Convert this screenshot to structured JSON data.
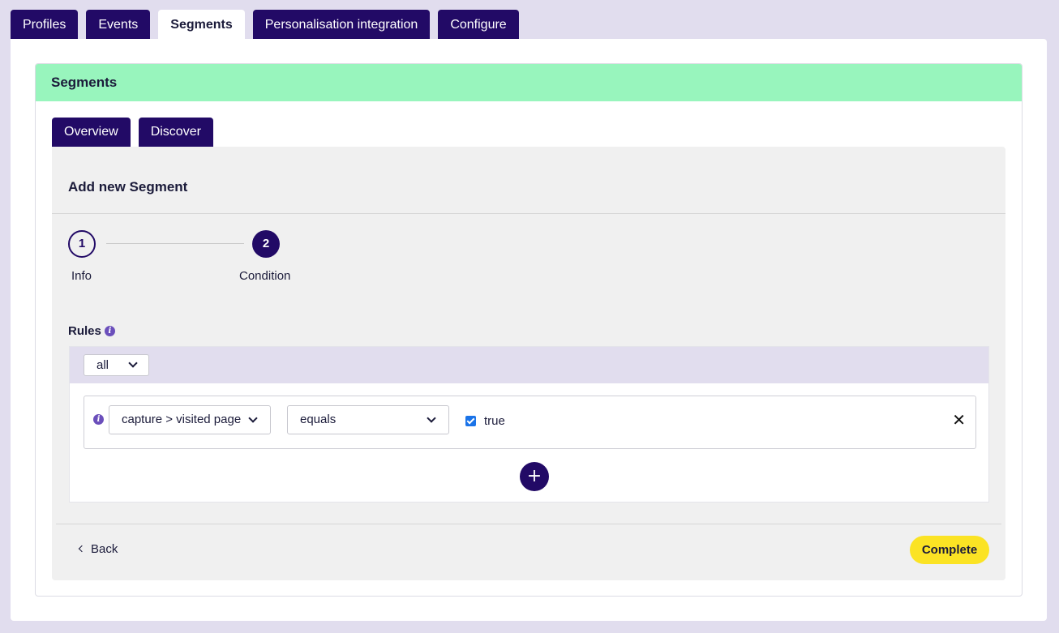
{
  "top_tabs": [
    "Profiles",
    "Events",
    "Segments",
    "Personalisation integration",
    "Configure"
  ],
  "active_top_tab": "Segments",
  "segments_header": "Segments",
  "sub_tabs": [
    "Overview",
    "Discover"
  ],
  "wizard": {
    "title": "Add new Segment",
    "steps": [
      {
        "number": "1",
        "label": "Info"
      },
      {
        "number": "2",
        "label": "Condition"
      }
    ],
    "current_step": 2
  },
  "rules": {
    "label": "Rules",
    "match_mode": "all",
    "rows": [
      {
        "field": "capture > visited page",
        "operator": "equals",
        "value_checked": true,
        "value_label": "true"
      }
    ]
  },
  "footer": {
    "back_label": "Back",
    "complete_label": "Complete"
  },
  "colors": {
    "tab_bg": "#220a66",
    "header_green": "#98f5bd",
    "complete_yellow": "#fbe324",
    "background": "#e1ddee"
  },
  "icons": [
    "info-icon",
    "chevron-down-icon",
    "close-icon",
    "plus-icon",
    "chevron-left-icon",
    "checkbox-checked-icon"
  ]
}
